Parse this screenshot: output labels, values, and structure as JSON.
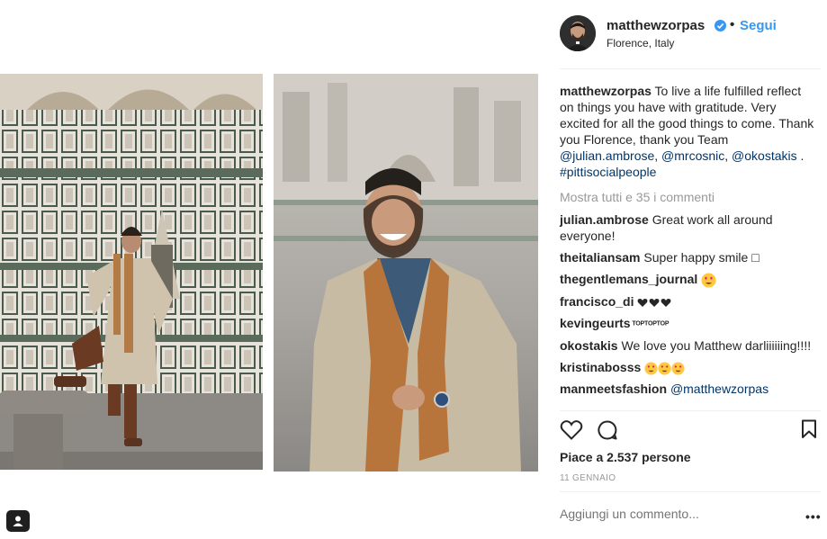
{
  "post": {
    "author": "matthewzorpas",
    "verified": true,
    "separator": "•",
    "follow_label": "Segui",
    "location": "Florence, Italy"
  },
  "caption": {
    "user": "matthewzorpas",
    "text": " To live a life fulfilled reflect on things you have with gratitude. Very excited for all the good things to come. Thank you Florence, thank you Team ",
    "mention1": "@julian.ambrose",
    "sep1": ", ",
    "mention2": "@mrcosnic",
    "sep2": ", ",
    "mention3": "@okostakis",
    "sep3": " . ",
    "hashtag": "#pittisocialpeople"
  },
  "show_all_comments": "Mostra tutti e 35 i commenti",
  "comments": [
    {
      "user": "julian.ambrose",
      "text": " Great work all around everyone!"
    },
    {
      "user": "theitaliansam",
      "text": " Super happy smile □"
    },
    {
      "user": "thegentlemans_journal",
      "text": " "
    },
    {
      "user": "francisco_di",
      "text": " "
    },
    {
      "user": "kevingeurts",
      "text": " TOPTOPTOP"
    },
    {
      "user": "okostakis",
      "text": " We love you Matthew darliiiiiing!!!!"
    },
    {
      "user": "kristinabosss",
      "text": " "
    },
    {
      "user": "manmeetsfashion",
      "text": " ",
      "mention": "@matthewzorpas"
    }
  ],
  "likes_text": "Piace a 2.537 persone",
  "date": "11 GENNAIO",
  "add_comment_placeholder": "Aggiungi un commento...",
  "more_label": "•••",
  "icons": {
    "like": "heart-outline-icon",
    "comment": "comment-bubble-icon",
    "save": "bookmark-icon",
    "tag": "user-tag-icon"
  },
  "colors": {
    "link": "#003569",
    "follow": "#3897f0",
    "muted": "#999999"
  }
}
